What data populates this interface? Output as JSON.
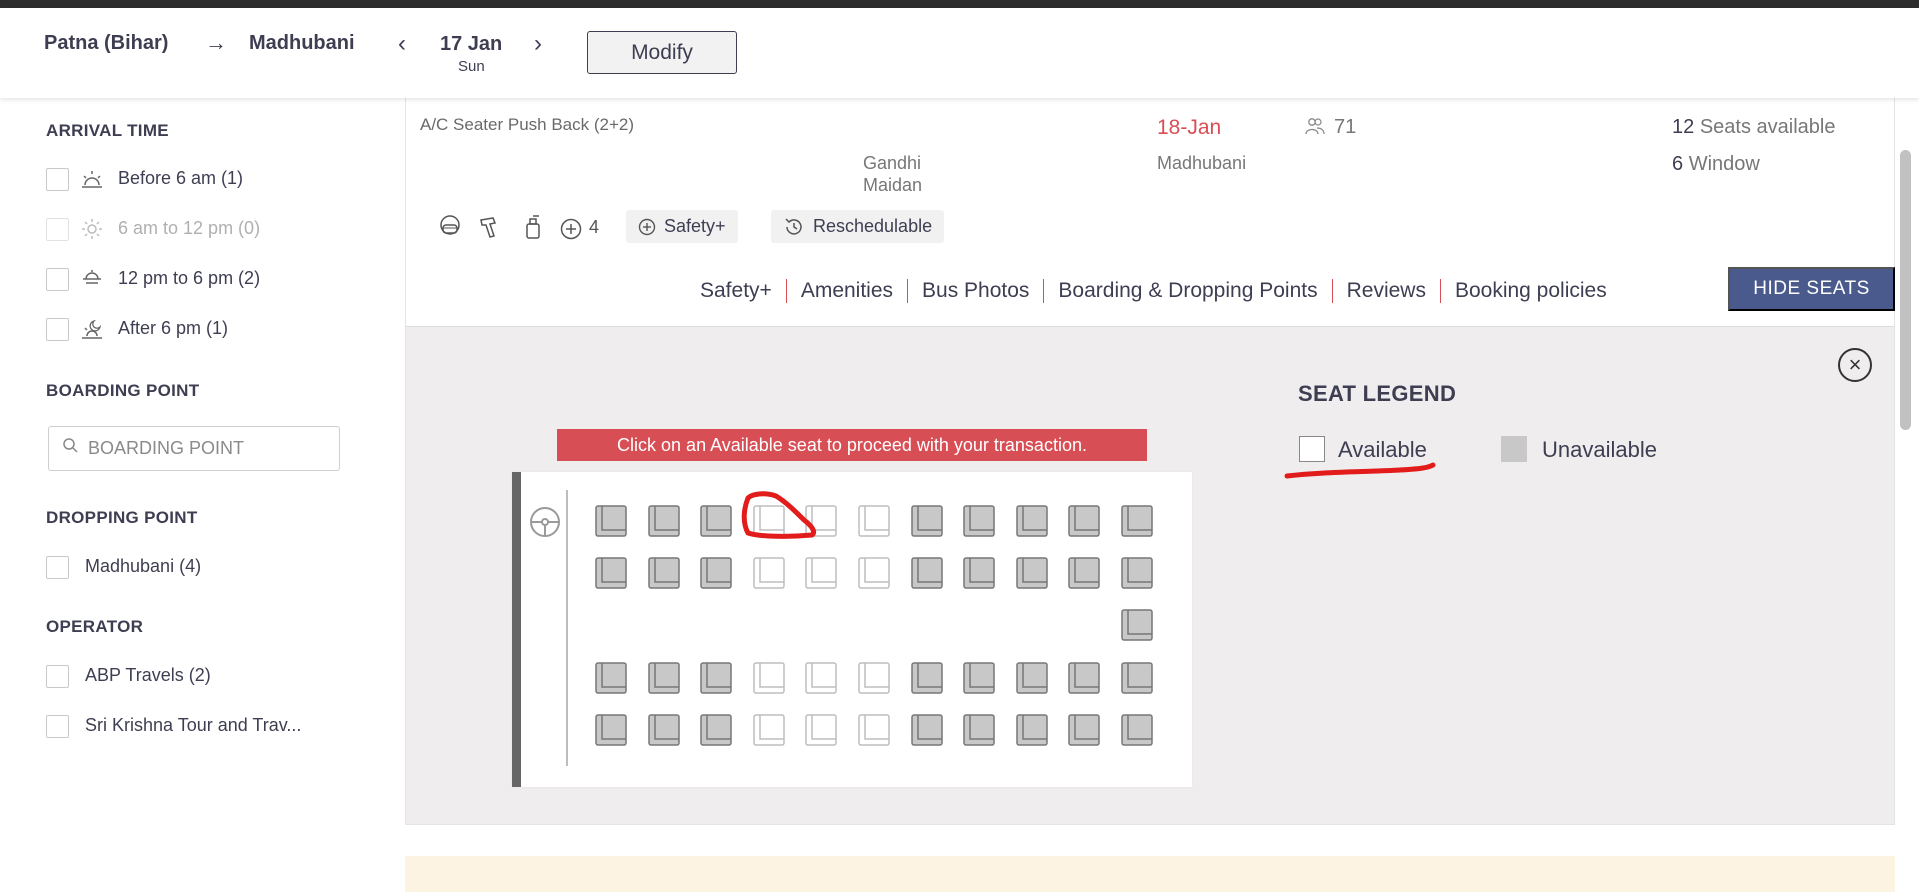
{
  "header": {
    "source": "Patna (Bihar)",
    "arrow": "→",
    "destination": "Madhubani",
    "prev": "‹",
    "date": "17 Jan",
    "day": "Sun",
    "next": "›",
    "modify_label": "Modify"
  },
  "sidebar": {
    "arrival_title": "ARRIVAL TIME",
    "arrival": [
      {
        "label": "Before 6 am (1)",
        "icon": "sunrise-icon",
        "disabled": false
      },
      {
        "label": "6 am to 12 pm (0)",
        "icon": "sun-icon",
        "disabled": true
      },
      {
        "label": "12 pm to 6 pm (2)",
        "icon": "sun-haze-icon",
        "disabled": false
      },
      {
        "label": "After 6 pm (1)",
        "icon": "sunset-icon",
        "disabled": false
      }
    ],
    "boarding_title": "BOARDING POINT",
    "boarding_placeholder": "BOARDING POINT",
    "dropping_title": "DROPPING POINT",
    "dropping": [
      "Madhubani (4)"
    ],
    "operator_title": "OPERATOR",
    "operators": [
      "ABP Travels (2)",
      "Sri Krishna Tour and Trav..."
    ]
  },
  "bus": {
    "type": "A/C Seater Push Back (2+2)",
    "boarding_point_line1": "Gandhi",
    "boarding_point_line2": "Maidan",
    "arrival_date": "18-Jan",
    "dropping_point": "Madhubani",
    "rating": "71",
    "seats_available_count": "12",
    "seats_available_text": "Seats available",
    "window_count": "6",
    "window_text": "Window",
    "amenities_more": "4",
    "tag_safety": "Safety+",
    "tag_reschedulable": "Reschedulable",
    "tabs": [
      "Safety+",
      "Amenities",
      "Bus Photos",
      "Boarding & Dropping Points",
      "Reviews",
      "Booking policies"
    ],
    "hide_seats_label": "HIDE SEATS"
  },
  "seat_layout": {
    "banner": "Click on an Available seat to proceed with your transaction.",
    "close": "×",
    "rows": [
      [
        0,
        0,
        0,
        1,
        1,
        1,
        0,
        0,
        0,
        0,
        0
      ],
      [
        0,
        0,
        0,
        1,
        1,
        1,
        0,
        0,
        0,
        0,
        0
      ],
      [
        null,
        null,
        null,
        null,
        null,
        null,
        null,
        null,
        null,
        null,
        0
      ],
      [
        0,
        0,
        0,
        1,
        1,
        1,
        0,
        0,
        0,
        0,
        0
      ],
      [
        0,
        0,
        0,
        1,
        1,
        1,
        0,
        0,
        0,
        0,
        0
      ]
    ],
    "legend_title": "SEAT LEGEND",
    "legend_available": "Available",
    "legend_unavailable": "Unavailable",
    "colors": {
      "available_fill": "#ffffff",
      "unavailable_fill": "#c8c8c8",
      "accent_red": "#d84e55",
      "hide_seats_bg": "#4a5a8c"
    }
  }
}
